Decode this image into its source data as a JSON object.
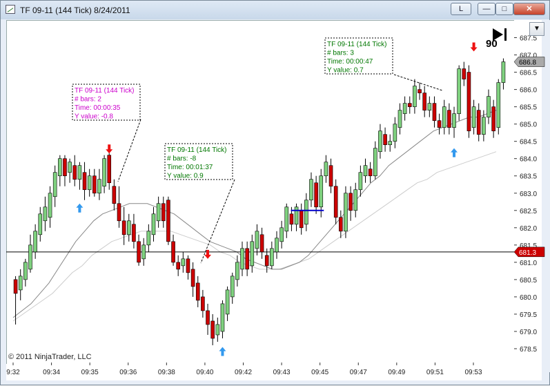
{
  "window": {
    "title": "TF 09-11 (144 Tick)  8/24/2011",
    "buttons": {
      "l_label": "L",
      "minimize_label": "—",
      "maximize_label": "□",
      "close_label": "✕"
    }
  },
  "overlay": {
    "copyright": "© 2011 NinjaTrader, LLC",
    "bars_count": "90",
    "menu_glyph": "▼"
  },
  "colors": {
    "up": "#7fd17f",
    "down": "#cc0000",
    "arrow_up": "#3399ee",
    "arrow_down": "#ee1111",
    "price_tag": "#cc0000",
    "hline": "#000000",
    "ray": "#0000cc"
  },
  "chart_data": {
    "type": "candlestick",
    "yaxis": {
      "range": [
        678.2,
        688.2
      ],
      "ticks": [
        "678.5",
        "679.0",
        "679.5",
        "680.0",
        "680.5",
        "681.0",
        "681.5",
        "682.0",
        "682.5",
        "683.0",
        "683.5",
        "684.0",
        "684.5",
        "685.0",
        "685.5",
        "686.0",
        "686.5",
        "687.0",
        "687.5"
      ]
    },
    "xaxis": {
      "ticks": [
        "9:32",
        "09:34",
        "09:35",
        "09:36",
        "09:38",
        "09:40",
        "09:42",
        "09:43",
        "09:45",
        "09:47",
        "09:49",
        "09:51",
        "09:53"
      ]
    },
    "last_price": "686.8",
    "horizontal_line_label": "681.3",
    "horizontal_line": 681.3,
    "candles": [
      [
        680.5,
        680.1,
        680.6,
        679.2
      ],
      [
        680.2,
        680.6,
        680.8,
        679.9
      ],
      [
        680.5,
        681.0,
        681.1,
        680.3
      ],
      [
        680.8,
        681.5,
        681.8,
        680.7
      ],
      [
        681.3,
        681.9,
        682.1,
        681.1
      ],
      [
        681.8,
        682.4,
        682.6,
        681.6
      ],
      [
        682.2,
        682.6,
        682.9,
        681.9
      ],
      [
        682.3,
        683.0,
        683.2,
        682.0
      ],
      [
        682.9,
        683.6,
        683.8,
        682.6
      ],
      [
        683.5,
        684.0,
        684.1,
        683.2
      ],
      [
        684.0,
        683.5,
        684.1,
        683.2
      ],
      [
        683.6,
        683.9,
        684.0,
        683.3
      ],
      [
        683.8,
        683.4,
        684.1,
        683.2
      ],
      [
        683.4,
        683.8,
        683.9,
        683.1
      ],
      [
        683.6,
        683.1,
        683.9,
        682.8
      ],
      [
        683.1,
        683.5,
        683.7,
        682.9
      ],
      [
        683.5,
        683.0,
        683.7,
        682.9
      ],
      [
        683.0,
        683.4,
        683.7,
        682.8
      ],
      [
        683.2,
        684.0,
        684.1,
        683.0
      ],
      [
        684.1,
        683.3,
        684.2,
        683.1
      ],
      [
        683.2,
        682.7,
        683.4,
        682.5
      ],
      [
        682.7,
        682.2,
        683.2,
        682.0
      ],
      [
        682.2,
        681.8,
        682.6,
        681.5
      ],
      [
        681.8,
        682.2,
        682.4,
        681.6
      ],
      [
        682.1,
        681.6,
        682.4,
        681.4
      ],
      [
        681.6,
        681.0,
        681.8,
        680.9
      ],
      [
        681.1,
        681.5,
        681.7,
        680.9
      ],
      [
        681.5,
        681.9,
        682.1,
        681.3
      ],
      [
        681.8,
        682.4,
        682.6,
        681.6
      ],
      [
        682.2,
        682.7,
        682.9,
        682.0
      ],
      [
        682.7,
        682.2,
        682.9,
        682.0
      ],
      [
        682.8,
        681.6,
        682.9,
        681.5
      ],
      [
        681.6,
        681.0,
        681.8,
        680.9
      ],
      [
        681.0,
        680.8,
        681.2,
        680.6
      ],
      [
        680.9,
        681.1,
        681.3,
        680.7
      ],
      [
        681.1,
        680.7,
        681.2,
        680.5
      ],
      [
        680.8,
        680.3,
        681.0,
        680.0
      ],
      [
        680.4,
        679.9,
        680.6,
        679.7
      ],
      [
        680.0,
        679.6,
        680.2,
        679.4
      ],
      [
        679.6,
        679.2,
        679.8,
        678.9
      ],
      [
        679.3,
        678.8,
        679.5,
        678.6
      ],
      [
        678.9,
        679.2,
        679.4,
        678.7
      ],
      [
        679.0,
        679.8,
        679.9,
        678.8
      ],
      [
        679.5,
        680.2,
        680.3,
        679.3
      ],
      [
        680.0,
        680.6,
        680.7,
        679.8
      ],
      [
        680.5,
        681.0,
        681.2,
        680.3
      ],
      [
        680.8,
        681.4,
        681.6,
        680.6
      ],
      [
        681.4,
        680.8,
        681.6,
        680.6
      ],
      [
        680.9,
        681.6,
        681.8,
        680.7
      ],
      [
        681.4,
        681.9,
        682.1,
        681.2
      ],
      [
        681.8,
        681.3,
        682.0,
        681.1
      ],
      [
        681.2,
        680.9,
        681.4,
        680.7
      ],
      [
        680.9,
        681.4,
        681.6,
        680.8
      ],
      [
        681.3,
        681.7,
        681.9,
        681.1
      ],
      [
        681.6,
        682.0,
        682.2,
        681.4
      ],
      [
        681.9,
        682.6,
        682.7,
        681.7
      ],
      [
        682.4,
        682.1,
        682.6,
        681.9
      ],
      [
        682.1,
        682.6,
        682.7,
        681.9
      ],
      [
        682.5,
        682.0,
        682.7,
        681.8
      ],
      [
        682.1,
        682.8,
        683.0,
        681.9
      ],
      [
        682.8,
        683.4,
        683.6,
        682.6
      ],
      [
        683.3,
        682.6,
        683.5,
        682.4
      ],
      [
        682.6,
        683.5,
        683.7,
        682.3
      ],
      [
        683.5,
        683.9,
        684.1,
        683.3
      ],
      [
        683.8,
        683.2,
        684.0,
        683.0
      ],
      [
        683.2,
        682.3,
        683.4,
        682.1
      ],
      [
        682.3,
        681.9,
        682.5,
        681.7
      ],
      [
        681.9,
        683.0,
        683.2,
        681.7
      ],
      [
        683.0,
        682.5,
        683.2,
        682.2
      ],
      [
        682.5,
        683.1,
        683.3,
        682.3
      ],
      [
        683.1,
        683.6,
        683.8,
        682.9
      ],
      [
        683.5,
        683.8,
        684.0,
        683.3
      ],
      [
        683.7,
        683.5,
        683.9,
        683.3
      ],
      [
        683.5,
        684.3,
        684.5,
        683.4
      ],
      [
        684.2,
        684.8,
        685.0,
        684.0
      ],
      [
        684.7,
        684.4,
        684.9,
        684.2
      ],
      [
        684.4,
        684.5,
        684.7,
        684.2
      ],
      [
        684.5,
        685.0,
        685.2,
        684.3
      ],
      [
        684.9,
        685.4,
        685.6,
        684.7
      ],
      [
        685.3,
        685.6,
        685.8,
        685.1
      ],
      [
        685.6,
        685.5,
        685.8,
        685.3
      ],
      [
        685.5,
        686.1,
        686.3,
        685.3
      ],
      [
        686.0,
        685.9,
        686.2,
        685.7
      ],
      [
        685.9,
        685.4,
        686.1,
        685.2
      ],
      [
        685.4,
        685.6,
        685.8,
        685.2
      ],
      [
        685.6,
        685.1,
        685.8,
        684.9
      ],
      [
        685.1,
        684.9,
        685.3,
        684.7
      ],
      [
        684.9,
        685.5,
        685.7,
        684.7
      ],
      [
        685.4,
        684.9,
        685.6,
        684.7
      ],
      [
        684.9,
        685.3,
        685.5,
        684.6
      ],
      [
        685.3,
        686.6,
        686.7,
        685.1
      ],
      [
        686.6,
        686.3,
        686.8,
        686.1
      ],
      [
        686.5,
        684.8,
        686.7,
        684.6
      ],
      [
        684.9,
        685.5,
        685.7,
        684.7
      ],
      [
        685.4,
        684.7,
        685.6,
        684.5
      ],
      [
        684.7,
        685.2,
        685.4,
        684.5
      ],
      [
        685.2,
        685.8,
        686.0,
        685.0
      ],
      [
        685.5,
        684.8,
        685.7,
        684.6
      ],
      [
        684.9,
        686.2,
        686.3,
        684.7
      ],
      [
        686.2,
        686.8,
        686.9,
        686.0
      ]
    ],
    "moving_average_1": [
      679.4,
      679.6,
      679.8,
      680.1,
      680.4,
      680.8,
      681.2,
      681.6,
      681.9,
      682.2,
      682.4,
      682.5,
      682.6,
      682.7,
      682.7,
      682.7,
      682.6,
      682.5,
      682.4,
      682.2,
      682.0,
      681.8,
      681.6,
      681.5,
      681.4,
      681.3,
      681.1,
      681.0,
      680.9,
      680.8,
      680.8,
      680.9,
      681.0,
      681.2,
      681.5,
      681.8,
      682.1,
      682.4,
      682.7,
      683.0,
      683.3,
      683.5,
      683.8,
      684.0,
      684.2,
      684.4,
      684.6,
      684.8,
      684.9,
      685.0,
      685.1,
      685.2,
      685.2,
      685.3,
      685.4
    ],
    "moving_average_2": [
      679.3,
      679.5,
      679.7,
      679.9,
      680.1,
      680.4,
      680.7,
      680.9,
      681.2,
      681.4,
      681.6,
      681.7,
      681.8,
      681.9,
      681.9,
      681.9,
      681.9,
      681.8,
      681.7,
      681.6,
      681.5,
      681.3,
      681.2,
      681.0,
      680.9,
      680.8,
      680.8,
      680.8,
      680.9,
      681.0,
      681.1,
      681.3,
      681.5,
      681.7,
      681.9,
      682.1,
      682.3,
      682.5,
      682.7,
      682.9,
      683.1,
      683.3,
      683.4,
      683.6,
      683.7,
      683.8,
      683.9,
      684.0,
      684.1,
      684.2
    ],
    "blue_ray": {
      "y": 682.5
    },
    "annotations": [
      {
        "lines": [
          "TF 09-11 (144 Tick)",
          "# bars:   2",
          "Time:     00:00:35",
          "Y value: -0.8"
        ],
        "color": "#cc00cc",
        "type": "box"
      },
      {
        "lines": [
          "TF 09-11 (144 Tick)",
          "# bars:   -8",
          "Time:     00:01:37",
          "Y value: 0.9"
        ],
        "color": "#007700",
        "type": "box"
      },
      {
        "lines": [
          "TF 09-11 (144 Tick)",
          "# bars:   3",
          "Time:     00:00:47",
          "Y value: 0.7"
        ],
        "color": "#007700",
        "type": "box"
      }
    ]
  }
}
